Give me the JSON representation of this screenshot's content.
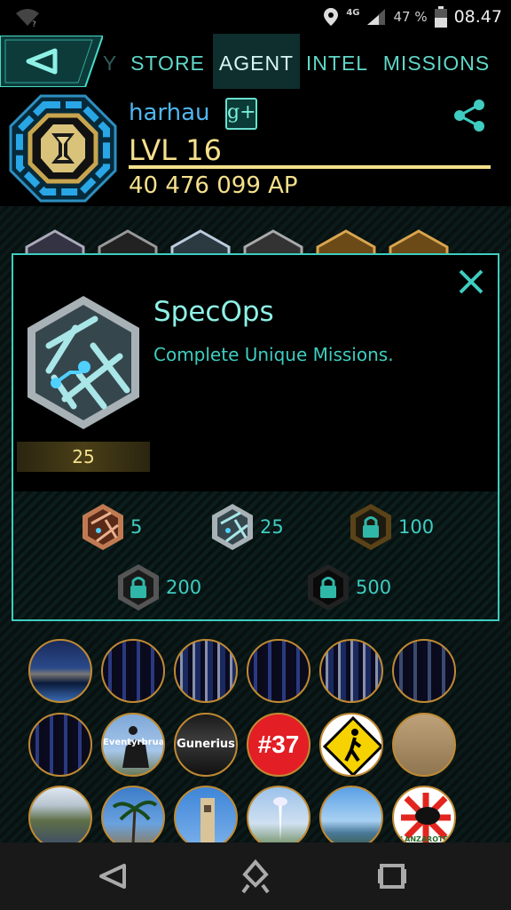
{
  "status_bar": {
    "network": "4G",
    "battery_percent": "47 %",
    "time": "08.47"
  },
  "nav": {
    "tabs": [
      {
        "label": "Y"
      },
      {
        "label": "STORE"
      },
      {
        "label": "AGENT"
      },
      {
        "label": "INTEL"
      },
      {
        "label": "MISSIONS"
      }
    ],
    "active_tab": "AGENT"
  },
  "agent": {
    "name": "harhau",
    "gplus_label": "g+",
    "level": "LVL 16",
    "ap": "40 476 099 AP"
  },
  "modal": {
    "title": "SpecOps",
    "description": "Complete Unique Missions.",
    "count": "25",
    "tiers": [
      {
        "value": "5",
        "tier": "bronze",
        "unlocked": true
      },
      {
        "value": "25",
        "tier": "silver",
        "unlocked": true
      },
      {
        "value": "100",
        "tier": "gold",
        "unlocked": false
      },
      {
        "value": "200",
        "tier": "platinum",
        "unlocked": false
      },
      {
        "value": "500",
        "tier": "onyx",
        "unlocked": false
      }
    ]
  },
  "missions": [
    {
      "label": ""
    },
    {
      "label": ""
    },
    {
      "label": ""
    },
    {
      "label": ""
    },
    {
      "label": ""
    },
    {
      "label": ""
    },
    {
      "label": ""
    },
    {
      "label": "Eventyrbrua"
    },
    {
      "label": "Gunerius"
    },
    {
      "label": "#37"
    },
    {
      "label": ""
    },
    {
      "label": ""
    },
    {
      "label": ""
    },
    {
      "label": ""
    },
    {
      "label": ""
    },
    {
      "label": ""
    },
    {
      "label": ""
    },
    {
      "label": "LANZAROTE"
    }
  ],
  "colors": {
    "accent_teal": "#3ecdc0",
    "level_gold": "#f4e08c",
    "name_blue": "#4fb6f0",
    "faction": "resistance-blue"
  }
}
